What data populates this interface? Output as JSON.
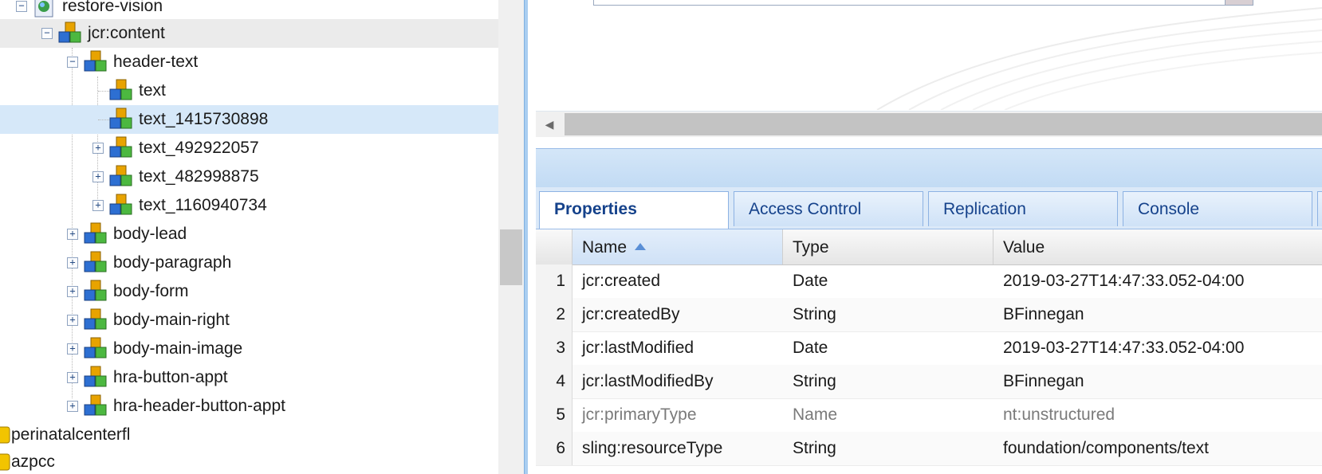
{
  "tree": {
    "nodes": [
      {
        "label": "restore-vision",
        "toggle": "−",
        "icon": "page-icon"
      },
      {
        "label": "jcr:content",
        "toggle": "−",
        "icon": "node-cubes-icon"
      },
      {
        "label": "header-text",
        "toggle": "−",
        "icon": "node-cubes-icon"
      },
      {
        "label": "text",
        "toggle": "",
        "icon": "node-cubes-icon"
      },
      {
        "label": "text_1415730898",
        "toggle": "",
        "icon": "node-cubes-icon"
      },
      {
        "label": "text_492922057",
        "toggle": "+",
        "icon": "node-cubes-icon"
      },
      {
        "label": "text_482998875",
        "toggle": "+",
        "icon": "node-cubes-icon"
      },
      {
        "label": "text_1160940734",
        "toggle": "+",
        "icon": "node-cubes-icon"
      },
      {
        "label": "body-lead",
        "toggle": "+",
        "icon": "node-cubes-icon"
      },
      {
        "label": "body-paragraph",
        "toggle": "+",
        "icon": "node-cubes-icon"
      },
      {
        "label": "body-form",
        "toggle": "+",
        "icon": "node-cubes-icon"
      },
      {
        "label": "body-main-right",
        "toggle": "+",
        "icon": "node-cubes-icon"
      },
      {
        "label": "body-main-image",
        "toggle": "+",
        "icon": "node-cubes-icon"
      },
      {
        "label": "hra-button-appt",
        "toggle": "+",
        "icon": "node-cubes-icon"
      },
      {
        "label": "hra-header-button-appt",
        "toggle": "+",
        "icon": "node-cubes-icon"
      },
      {
        "label": "perinatalcenterfl",
        "toggle": "",
        "icon": "folder-icon"
      },
      {
        "label": "azpcc",
        "toggle": "",
        "icon": "folder-icon"
      }
    ]
  },
  "tabs": [
    "Properties",
    "Access Control",
    "Replication",
    "Console"
  ],
  "grid": {
    "columns": {
      "name": "Name",
      "type": "Type",
      "value": "Value"
    },
    "rows": [
      {
        "n": "1",
        "name": "jcr:created",
        "type": "Date",
        "value": "2019-03-27T14:47:33.052-04:00"
      },
      {
        "n": "2",
        "name": "jcr:createdBy",
        "type": "String",
        "value": "BFinnegan"
      },
      {
        "n": "3",
        "name": "jcr:lastModified",
        "type": "Date",
        "value": "2019-03-27T14:47:33.052-04:00"
      },
      {
        "n": "4",
        "name": "jcr:lastModifiedBy",
        "type": "String",
        "value": "BFinnegan"
      },
      {
        "n": "5",
        "name": "jcr:primaryType",
        "type": "Name",
        "value": "nt:unstructured"
      },
      {
        "n": "6",
        "name": "sling:resourceType",
        "type": "String",
        "value": "foundation/components/text"
      }
    ]
  },
  "colors": {
    "selection": "#d6e8f9",
    "accent": "#15428b"
  }
}
